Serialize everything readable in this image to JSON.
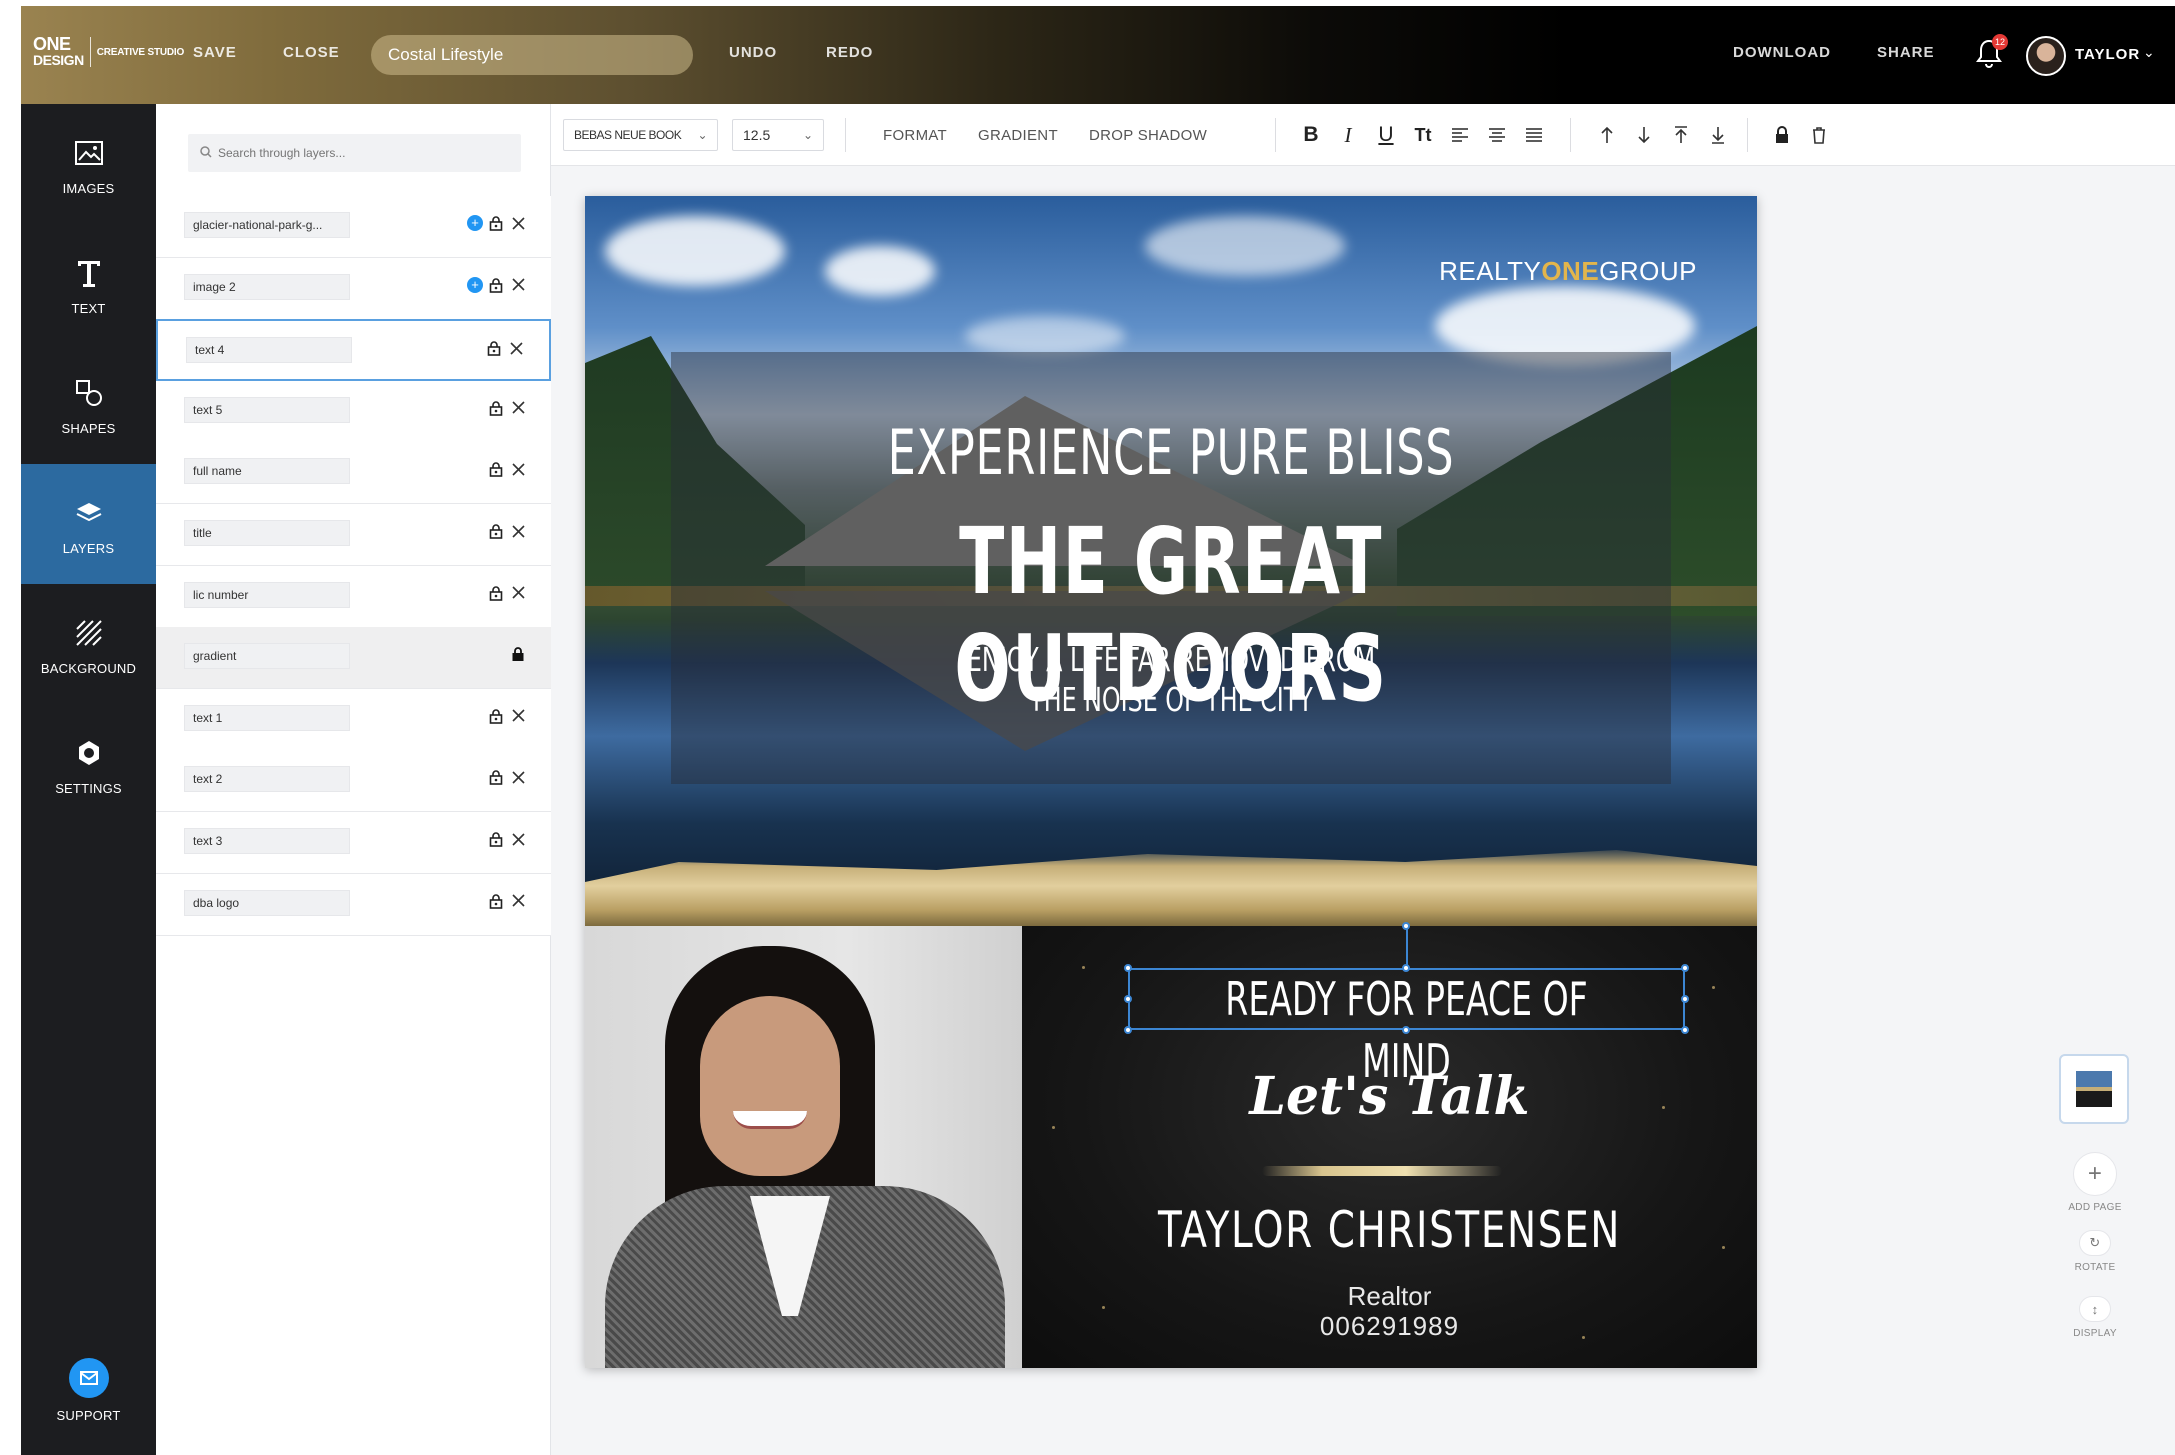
{
  "topbar": {
    "logo_line1": "ONE",
    "logo_line2": "DESIGN",
    "logo_sub": "CREATIVE STUDIO",
    "save": "SAVE",
    "close": "CLOSE",
    "doc_name": "Costal Lifestyle",
    "undo": "UNDO",
    "redo": "REDO",
    "download": "DOWNLOAD",
    "share": "SHARE",
    "notification_count": "12",
    "user_name": "TAYLOR"
  },
  "rail": {
    "images": "IMAGES",
    "text": "TEXT",
    "shapes": "SHAPES",
    "layers": "LAYERS",
    "background": "BACKGROUND",
    "settings": "SETTINGS",
    "support": "SUPPORT",
    "active": "LAYERS",
    "active_color": "#2c6aa0"
  },
  "layers": {
    "search_placeholder": "Search through layers...",
    "items": [
      {
        "name": "glacier-national-park-g...",
        "has_add": true
      },
      {
        "name": "image 2",
        "has_add": true
      },
      {
        "name": "text 4",
        "selected": true
      },
      {
        "name": "text 5"
      },
      {
        "name": "full name"
      },
      {
        "name": "title"
      },
      {
        "name": "lic number"
      },
      {
        "name": "gradient",
        "locked": true
      },
      {
        "name": "text 1"
      },
      {
        "name": "text 2"
      },
      {
        "name": "text 3"
      },
      {
        "name": "dba logo"
      }
    ]
  },
  "format_bar": {
    "font": "BEBAS NEUE BOOK",
    "size": "12.5",
    "format": "FORMAT",
    "gradient": "GRADIENT",
    "drop_shadow": "DROP SHADOW",
    "bold": "B",
    "italic": "I",
    "underline": "U",
    "case": "Tt"
  },
  "canvas": {
    "brand_a": "REALTY",
    "brand_b": "ONE",
    "brand_c": "GROUP",
    "headline_sub": "EXPERIENCE PURE BLISS",
    "headline_main": "THE GREAT OUTDOORS",
    "body_line1": "ENJOY A LIFE FAR REMOVED FROM",
    "body_line2": "THE NOISE OF THE CITY",
    "ready": "READY FOR PEACE OF MIND",
    "lets_talk": "Let's Talk",
    "full_name": "TAYLOR  CHRISTENSEN",
    "title": "Realtor",
    "lic_number": "006291989",
    "gold_color": "#e2b54c"
  },
  "page_controls": {
    "add_page": "ADD PAGE",
    "rotate": "ROTATE",
    "display": "DISPLAY"
  }
}
